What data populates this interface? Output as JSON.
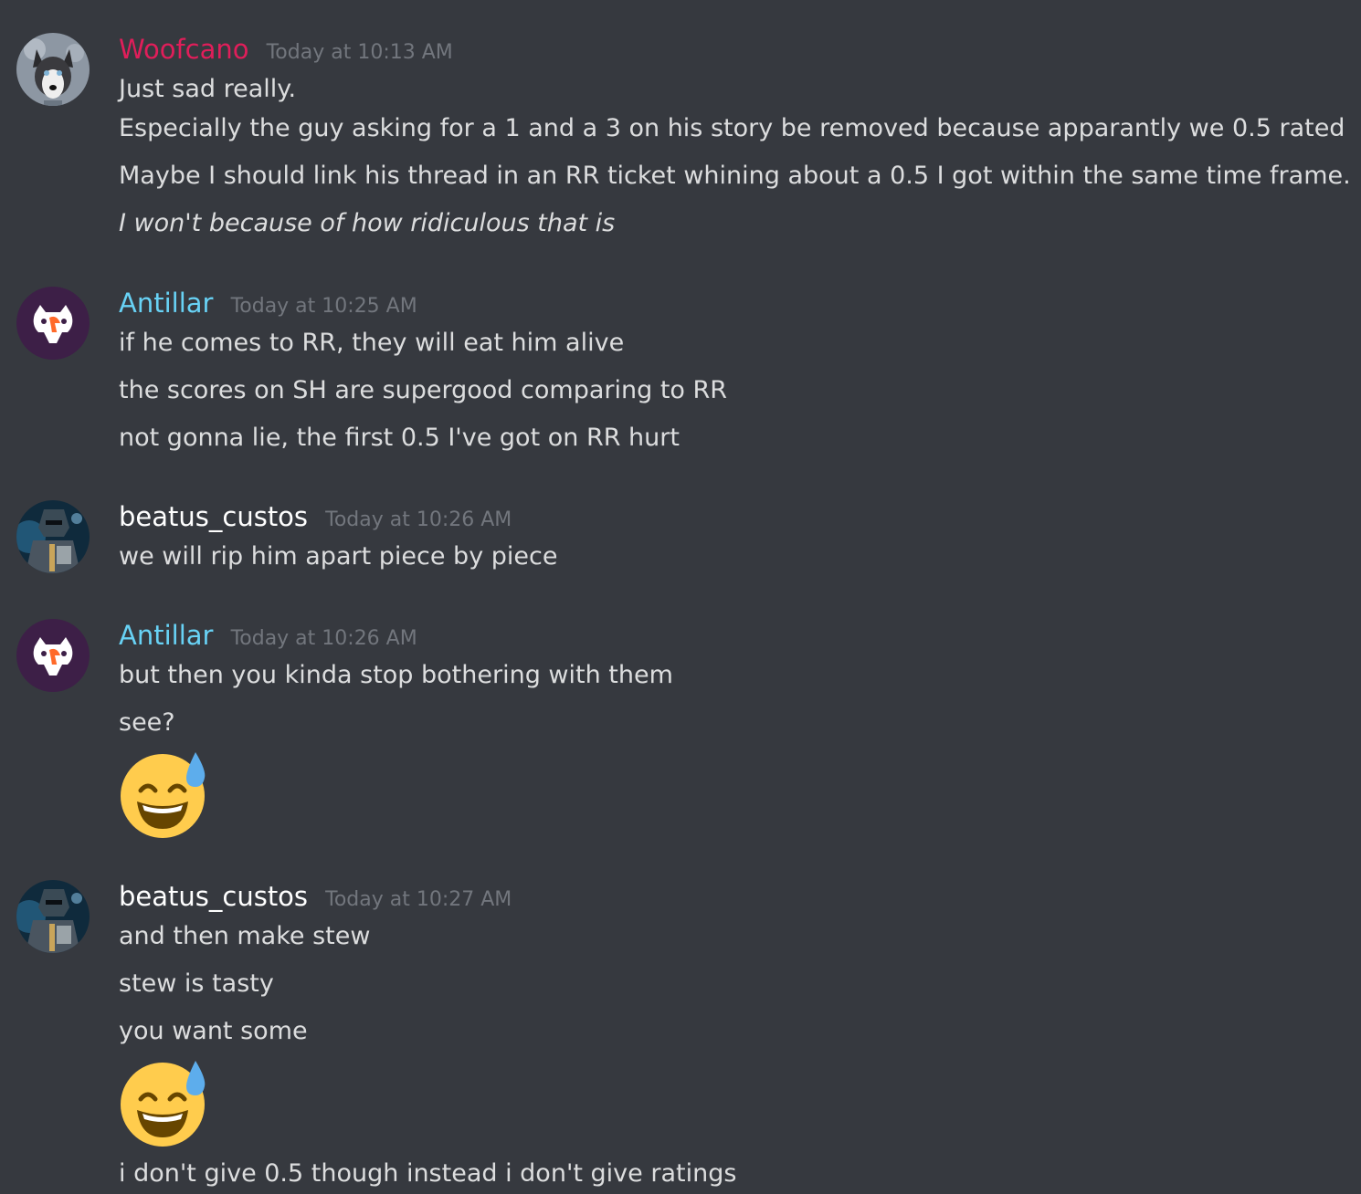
{
  "colors": {
    "background": "#36393f",
    "text": "#dcddde",
    "timestamp": "#72767d",
    "woofcano": "#e01e5a",
    "antillar": "#68d2f5",
    "beatus_custos": "#ffffff"
  },
  "messages": [
    {
      "author": "Woofcano",
      "timestamp": "Today at 10:13 AM",
      "avatar_icon": "husky-avatar",
      "lines": [
        "Just sad really.",
        "Especially the guy asking for a 1 and a 3 on his story be removed because apparantly we 0.5 rated",
        "Maybe I should link his thread in an RR ticket whining about a 0.5 I got within the same time frame.",
        "I won't because of how ridiculous that is"
      ]
    },
    {
      "author": "Antillar",
      "timestamp": "Today at 10:25 AM",
      "avatar_icon": "cat-logo-avatar",
      "lines": [
        "if he comes to RR, they will eat him alive",
        "the scores on SH are supergood comparing to RR",
        "not gonna lie, the first 0.5 I've got on RR hurt"
      ]
    },
    {
      "author": "beatus_custos",
      "timestamp": "Today at 10:26 AM",
      "avatar_icon": "armored-knight-avatar",
      "lines": [
        "we will rip him apart piece by piece"
      ]
    },
    {
      "author": "Antillar",
      "timestamp": "Today at 10:26 AM",
      "avatar_icon": "cat-logo-avatar",
      "lines": [
        "but then you kinda stop bothering with them",
        "see?"
      ],
      "emoji": "sweat-smile-emoji"
    },
    {
      "author": "beatus_custos",
      "timestamp": "Today at 10:27 AM",
      "avatar_icon": "armored-knight-avatar",
      "lines": [
        "and then make stew",
        "stew is tasty",
        "you want some",
        "i don't give 0.5 though instead i don't give ratings"
      ],
      "emoji": "sweat-smile-emoji"
    }
  ]
}
